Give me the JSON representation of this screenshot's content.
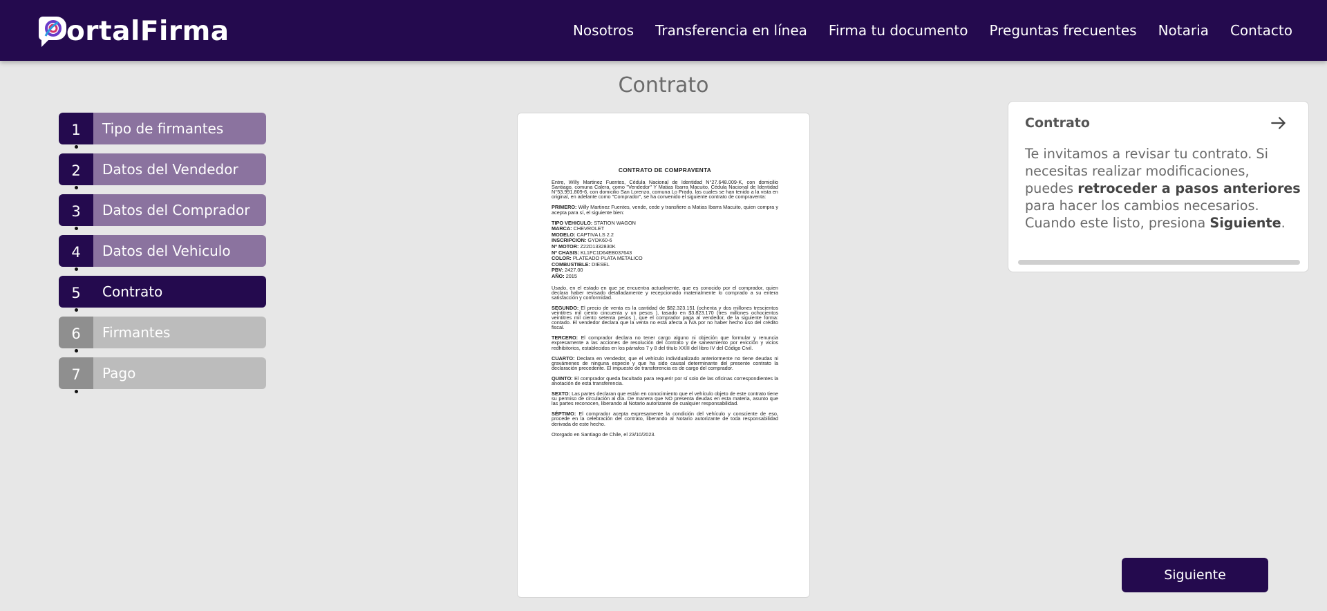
{
  "header": {
    "logo_text": "ortalFirma",
    "logo_mark": "P-speech-bubble-logo",
    "nav": [
      {
        "label": "Nosotros"
      },
      {
        "label": "Transferencia en línea"
      },
      {
        "label": "Firma tu documento"
      },
      {
        "label": "Preguntas frecuentes"
      },
      {
        "label": "Notaria"
      },
      {
        "label": "Contacto"
      }
    ],
    "bg_color": "#240a4e"
  },
  "page": {
    "title": "Contrato"
  },
  "steps": [
    {
      "num": "1",
      "label": "Tipo de firmantes",
      "state": "done"
    },
    {
      "num": "2",
      "label": "Datos del Vendedor",
      "state": "done"
    },
    {
      "num": "3",
      "label": "Datos del Comprador",
      "state": "done"
    },
    {
      "num": "4",
      "label": "Datos del Vehiculo",
      "state": "done"
    },
    {
      "num": "5",
      "label": "Contrato",
      "state": "active"
    },
    {
      "num": "6",
      "label": "Firmantes",
      "state": "todo"
    },
    {
      "num": "7",
      "label": "Pago",
      "state": "todo"
    }
  ],
  "document": {
    "title": "CONTRATO DE COMPRAVENTA",
    "intro": "Entre, Willy Martinez Fuentes, Cédula Nacional de Identidad N°27.648.009-K, con domicilio Santiago, comuna Calera, como \"Vendedor\" Y Matias Ibarra Macuito, Cédula Nacional de Identidad N°53.991.809-6, con domicilio San Lorenzo, comuna Lo Prado, las cuales se han tenido a la vista en original, en adelante como \"Comprador\", se ha convenido el siguiente contrato de compraventa:",
    "primero_label": "PRIMERO:",
    "primero": "Willy Martinez Fuentes, vende, cede y transfiere a Matias Ibarra Macuito, quien compra y acepta para sí, el siguiente bien:",
    "vehicle": [
      {
        "k": "TIPO VEHICULO:",
        "v": "STATION WAGON"
      },
      {
        "k": "MARCA:",
        "v": "CHEVROLET"
      },
      {
        "k": "MODELO:",
        "v": "CAPTIVA LS 2.2"
      },
      {
        "k": "INSCRIPCION:",
        "v": "GYDK60-6"
      },
      {
        "k": "Nº MOTOR:",
        "v": "Z22D1332830K"
      },
      {
        "k": "Nº CHASIS:",
        "v": "KL1FC1D64EB037643"
      },
      {
        "k": "COLOR:",
        "v": "PLATEADO PLATA METALICO"
      },
      {
        "k": "COMBUSTIBLE:",
        "v": "DIESEL"
      },
      {
        "k": "PBV:",
        "v": "2427.00"
      },
      {
        "k": "AÑO:",
        "v": "2015"
      }
    ],
    "usado": "Usado, en el estado en que se encuentra actualmente, que es conocido por el comprador, quien declara haber revisado detalladamente y recepcionado materialmente lo comprado a su entera satisfacción y conformidad.",
    "segundo_label": "SEGUNDO:",
    "segundo": "El precio de venta es la cantidad de $82.323.151 (ochenta y dos millones trescientos veintitres mil ciento cincuenta y un pesos ), tasado en $3.823.170 (tres millones ochocientos veintitres mil ciento setenta pesos ), que el comprador paga al vendedor, de la siguiente forma: contado. El vendedor declara que la venta no está afecta a IVA por no haber hecho uso del crédito fiscal.",
    "tercero_label": "TERCERO:",
    "tercero": "El comprador declara no tener cargo alguno ni objeción que formular y renuncia expresamente a las acciones de resolución del contrato y de saneamiento por evicción y vicios redhibitorios, establecidos en los párrafos 7 y 8 del título XXIII del libro IV del Código Civil.",
    "cuarto_label": "CUARTO:",
    "cuarto": "Declara en vendedor, que el vehículo individualizado anteriormente no tiene deudas ni gravámenes de ninguna especie y que ha sido causal determinante del presente contrato la declaración precedente. El impuesto de transferencia es de cargo del comprador.",
    "quinto_label": "QUINTO:",
    "quinto": "El comprador queda facultado para requerir por sí solo de las oficinas correspondientes la anotación de esta transferencia.",
    "sexto_label": "SEXTO:",
    "sexto": "Las partes declaran que están en conocimiento que el vehículo objeto de este contrato tiene su permiso de circulación al día. De manera que NO presenta deudas en esta materia, asunto que las partes reconocen, liberando al Notario autorizante de cualquier responsabilidad.",
    "septimo_label": "SÉPTIMO:",
    "septimo": "El comprador acepta expresamente la condición del vehículo y consciente de eso, procede en la celebración del contrato, liberando al Notario autorizante de toda responsabilidad derivada de este hecho.",
    "closing": "Otorgado en Santiago de Chile, el 23/10/2023."
  },
  "card": {
    "title": "Contrato",
    "arrow_icon": "arrow-right-icon",
    "text1": "Te invitamos a revisar tu contrato. Si necesitas realizar modificaciones, puedes ",
    "text_bold1": "retroceder a pasos anteriores",
    "text2": " para hacer los cambios necesarios.",
    "text3": "Cuando este listo, presiona ",
    "text_bold2": "Siguiente",
    "text4": "."
  },
  "footer": {
    "next_label": "Siguiente"
  }
}
